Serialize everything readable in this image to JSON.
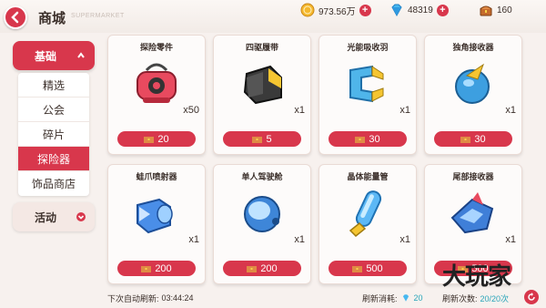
{
  "header": {
    "title": "商城",
    "subtitle": "SUPERMARKET",
    "gold": "973.56万",
    "gems": "48319",
    "chests": "160"
  },
  "sidebar": {
    "category_basic": "基础",
    "items": [
      {
        "label": "精选"
      },
      {
        "label": "公会"
      },
      {
        "label": "碎片"
      },
      {
        "label": "探险器"
      },
      {
        "label": "饰品商店"
      }
    ],
    "category_activity": "活动"
  },
  "products": [
    {
      "name": "探险零件",
      "qty": "x50",
      "price": "20",
      "icon": "red-device-icon"
    },
    {
      "name": "四驱履带",
      "qty": "x1",
      "price": "5",
      "icon": "track-block-icon"
    },
    {
      "name": "光能吸收羽",
      "qty": "x1",
      "price": "30",
      "icon": "blue-clamp-icon"
    },
    {
      "name": "独角接收器",
      "qty": "x1",
      "price": "30",
      "icon": "blue-orb-icon"
    },
    {
      "name": "蛙爪喷射器",
      "qty": "x1",
      "price": "200",
      "icon": "blue-thruster-icon"
    },
    {
      "name": "单人驾驶舱",
      "qty": "x1",
      "price": "200",
      "icon": "glass-pod-icon"
    },
    {
      "name": "晶体能量管",
      "qty": "x1",
      "price": "500",
      "icon": "crystal-tube-icon"
    },
    {
      "name": "尾部接收器",
      "qty": "x1",
      "price": "500",
      "icon": "tail-receiver-icon"
    }
  ],
  "footer": {
    "refresh_label": "下次自动刷新:",
    "refresh_time": "03:44:24",
    "cost_label": "刷新消耗:",
    "cost_value": "20",
    "count_label": "刷新次数:",
    "count_value": "20/20次"
  },
  "watermark": "大玩家",
  "colors": {
    "accent": "#d8374c",
    "card_bg": "#fdfbfa",
    "page_bg": "#f7f1ee"
  }
}
